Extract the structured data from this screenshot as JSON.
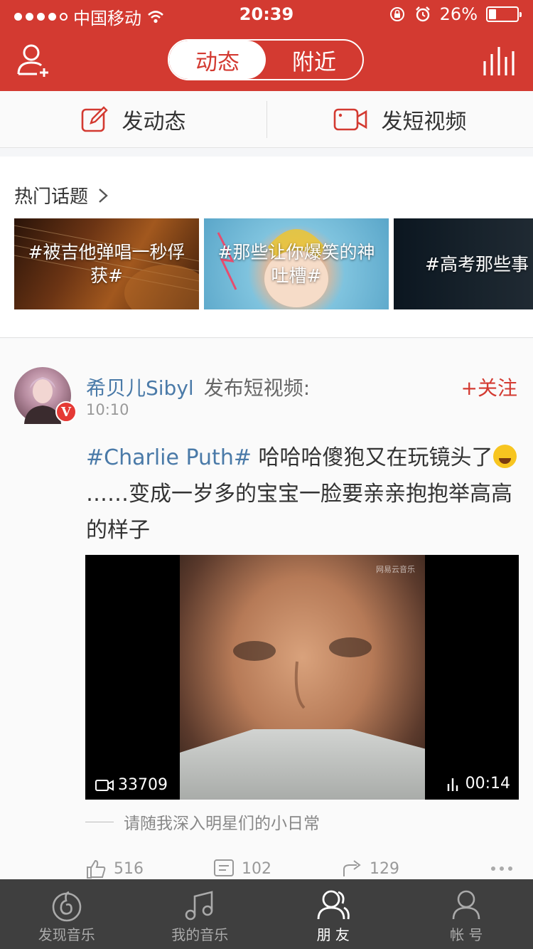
{
  "status": {
    "carrier": "中国移动",
    "time": "20:39",
    "battery": "26%",
    "battery_level": 0.26
  },
  "header": {
    "tabs": [
      {
        "label": "动态",
        "active": true
      },
      {
        "label": "附近",
        "active": false
      }
    ],
    "icons": [
      "add-user-icon",
      "rank-icon"
    ]
  },
  "actions": {
    "post_label": "发动态",
    "video_label": "发短视频"
  },
  "topics": {
    "title": "热门话题",
    "cards": [
      {
        "label": "#被吉他弹唱一秒俘获#"
      },
      {
        "label": "#那些让你爆笑的神吐槽#"
      },
      {
        "label": "#高考那些事"
      }
    ]
  },
  "post": {
    "author": "希贝儿Sibyl",
    "action": "发布短视频:",
    "time": "10:10",
    "follow": "+关注",
    "hashtag": "#Charlie Puth#",
    "text_before_emoji": " 哈哈哈傻狍又在玩镜头了",
    "text_after_emoji": "……变成一岁多的宝宝一脸要亲亲抱抱举高高的样子",
    "video": {
      "watermark": "网易云音乐",
      "views": "33709",
      "duration": "00:14"
    },
    "caption": "请随我深入明星们的小日常",
    "likes": "516",
    "comments": "102",
    "shares": "129"
  },
  "tabbar": {
    "items": [
      {
        "label": "发现音乐",
        "active": false
      },
      {
        "label": "我的音乐",
        "active": false
      },
      {
        "label": "朋 友",
        "active": true
      },
      {
        "label": "帐 号",
        "active": false
      }
    ]
  },
  "colors": {
    "brand_red": "#d33a31",
    "link_blue": "#4a7aa8",
    "tabbar_bg": "#3f3f3f"
  }
}
